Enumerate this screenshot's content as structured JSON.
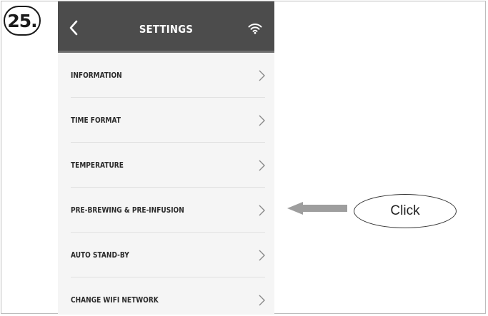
{
  "step": {
    "label": "25."
  },
  "header": {
    "title": "SETTINGS",
    "back_icon": "chevron-left-icon",
    "wifi_icon": "wifi-icon"
  },
  "menu": {
    "items": [
      {
        "label": "INFORMATION"
      },
      {
        "label": "TIME FORMAT"
      },
      {
        "label": "TEMPERATURE"
      },
      {
        "label": "PRE-BREWING & PRE-INFUSION"
      },
      {
        "label": "AUTO STAND-BY"
      },
      {
        "label": "CHANGE WIFI NETWORK"
      }
    ]
  },
  "callout": {
    "label": "Click",
    "target": "PRE-BREWING & PRE-INFUSION"
  },
  "colors": {
    "header_bg": "#4c4c4c",
    "list_bg": "#f5f5f5",
    "arrow": "#9e9e9e",
    "text": "#2a2a2a"
  }
}
